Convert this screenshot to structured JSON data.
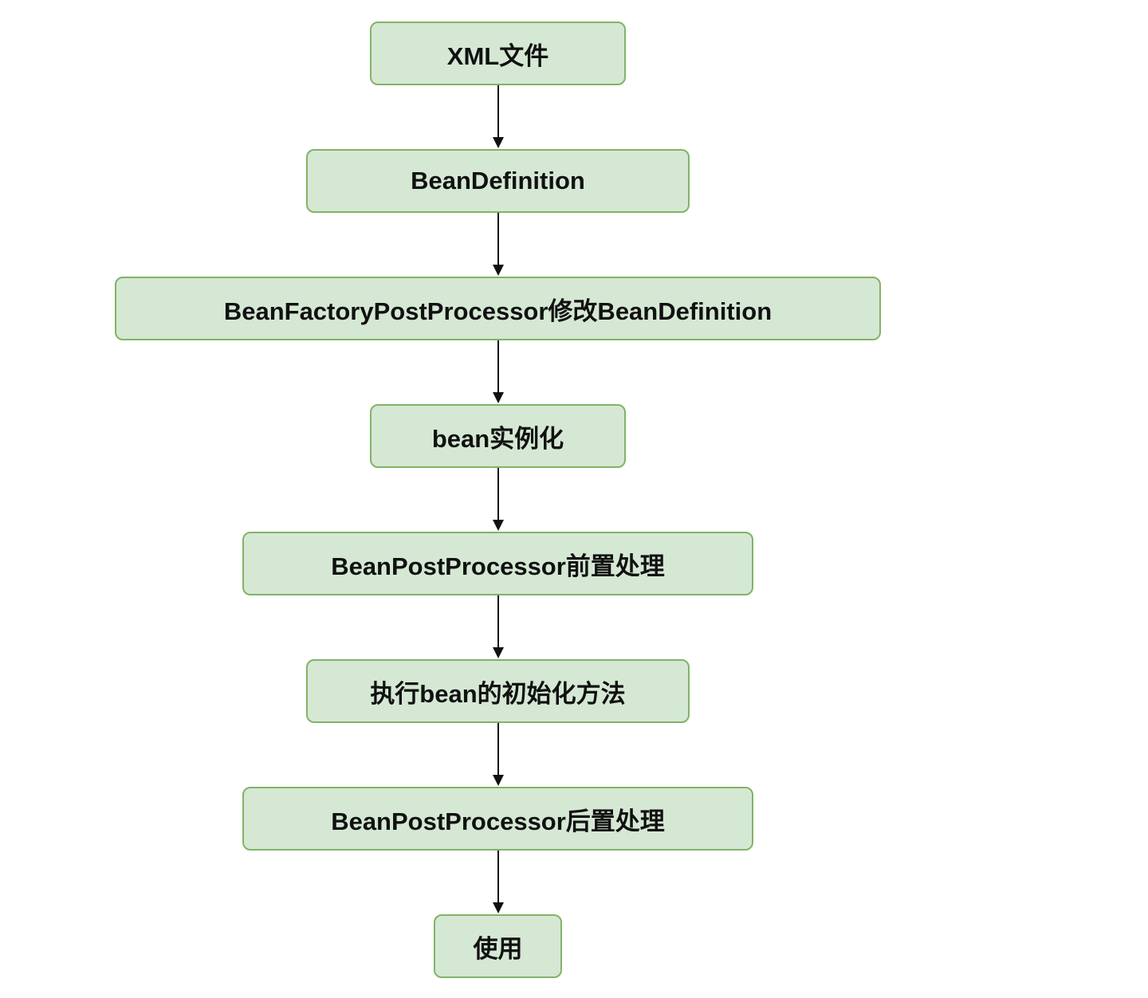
{
  "nodes": [
    {
      "label": "XML文件"
    },
    {
      "label": "BeanDefinition"
    },
    {
      "label": "BeanFactoryPostProcessor修改BeanDefinition"
    },
    {
      "label": "bean实例化"
    },
    {
      "label": "BeanPostProcessor前置处理"
    },
    {
      "label": "执行bean的初始化方法"
    },
    {
      "label": "BeanPostProcessor后置处理"
    },
    {
      "label": "使用"
    }
  ],
  "edges": [
    {
      "from": 0,
      "to": 1
    },
    {
      "from": 1,
      "to": 2
    },
    {
      "from": 2,
      "to": 3
    },
    {
      "from": 3,
      "to": 4
    },
    {
      "from": 4,
      "to": 5
    },
    {
      "from": 5,
      "to": 6
    },
    {
      "from": 6,
      "to": 7
    }
  ],
  "colors": {
    "node_fill": "#d5e8d4",
    "node_border": "#82b366",
    "edge": "#111111",
    "text": "#111111"
  }
}
